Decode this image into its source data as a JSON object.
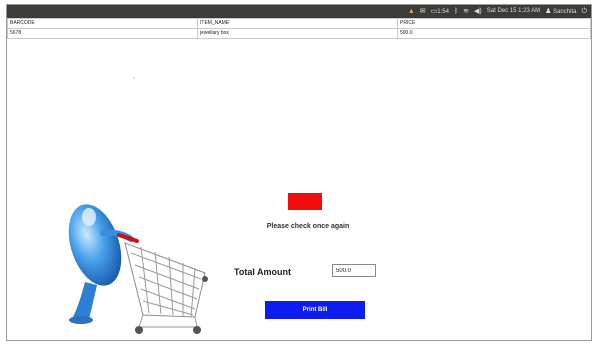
{
  "system_bar": {
    "items": [
      {
        "icon": "warning-icon",
        "text": ""
      },
      {
        "icon": "mail-icon",
        "text": ""
      },
      {
        "icon": "battery-icon",
        "text": "1:54"
      },
      {
        "icon": "bluetooth-icon",
        "text": ""
      },
      {
        "icon": "wifi-icon",
        "text": ""
      },
      {
        "icon": "volume-icon",
        "text": ""
      },
      {
        "icon": "",
        "text": "Sat Dec 15 1:23 AM"
      },
      {
        "icon": "user-icon",
        "text": "Sanchita"
      },
      {
        "icon": "power-icon",
        "text": ""
      }
    ]
  },
  "table": {
    "headers": [
      "BARCODE",
      "ITEM_NAME",
      "PRICE"
    ],
    "rows": [
      [
        "5678",
        "jewellary box",
        "500.0"
      ]
    ]
  },
  "status": {
    "color": "#f20d0d",
    "message": "Please check once again"
  },
  "total": {
    "label": "Total Amount",
    "value": "500.0"
  },
  "print_button": {
    "label": "Print Bill",
    "color": "#0d1df0"
  }
}
